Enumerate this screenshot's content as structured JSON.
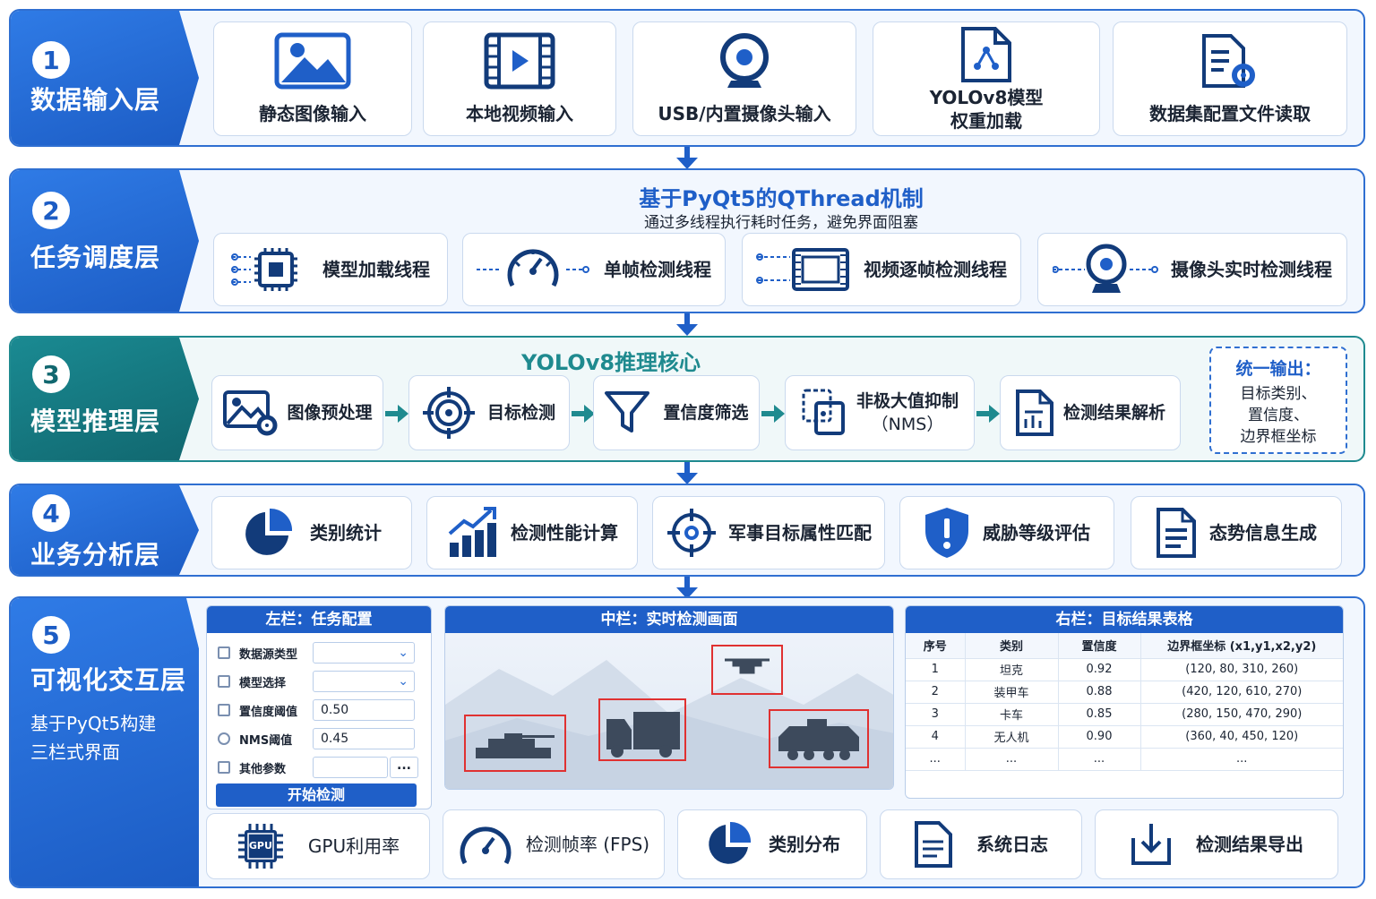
{
  "layer1": {
    "num": "1",
    "name": "数据输入层",
    "cards": [
      "静态图像输入",
      "本地视频输入",
      "USB/内置摄像头输入",
      "YOLOv8模型",
      "权重加载",
      "数据集配置文件读取"
    ]
  },
  "layer2": {
    "num": "2",
    "name": "任务调度层",
    "title": "基于PyQt5的QThread机制",
    "subtitle": "通过多线程执行耗时任务，避免界面阻塞",
    "cards": [
      "模型加载线程",
      "单帧检测线程",
      "视频逐帧检测线程",
      "摄像头实时检测线程"
    ]
  },
  "layer3": {
    "num": "3",
    "name": "模型推理层",
    "title": "YOLOv8推理核心",
    "cards": [
      "图像预处理",
      "目标检测",
      "置信度筛选",
      "非极大值抑制",
      "（NMS）",
      "检测结果解析"
    ],
    "output_title": "统一输出：",
    "output_lines": [
      "目标类别、",
      "置信度、",
      "边界框坐标"
    ]
  },
  "layer4": {
    "num": "4",
    "name": "业务分析层",
    "cards": [
      "类别统计",
      "检测性能计算",
      "军事目标属性匹配",
      "威胁等级评估",
      "态势信息生成"
    ]
  },
  "layer5": {
    "num": "5",
    "name": "可视化交互层",
    "sub1": "基于PyQt5构建",
    "sub2": "三栏式界面",
    "left": {
      "title": "左栏：任务配置",
      "fields": [
        "数据源类型",
        "模型选择",
        "置信度阈值",
        "NMS阈值",
        "其他参数"
      ],
      "conf_value": "0.50",
      "nms_value": "0.45",
      "more": "...",
      "button": "开始检测"
    },
    "center": {
      "title": "中栏：实时检测画面"
    },
    "right": {
      "title": "右栏：目标结果表格",
      "headers": [
        "序号",
        "类别",
        "置信度",
        "边界框坐标 (x1,y1,x2,y2)"
      ],
      "rows": [
        [
          "1",
          "坦克",
          "0.92",
          "(120, 80, 310, 260)"
        ],
        [
          "2",
          "装甲车",
          "0.88",
          "(420, 120, 610, 270)"
        ],
        [
          "3",
          "卡车",
          "0.85",
          "(280, 150, 470, 290)"
        ],
        [
          "4",
          "无人机",
          "0.90",
          "(360, 40, 450, 120)"
        ],
        [
          "...",
          "...",
          "...",
          "..."
        ]
      ]
    },
    "bottom": [
      "GPU利用率",
      "检测帧率 (FPS)",
      "类别分布",
      "系统日志",
      "检测结果导出"
    ],
    "gpu_chip": "GPU"
  },
  "colors": {
    "primary": "#1f5fc8",
    "dark": "#123b7a",
    "teal": "#1f8a8f",
    "red": "#e03131"
  }
}
